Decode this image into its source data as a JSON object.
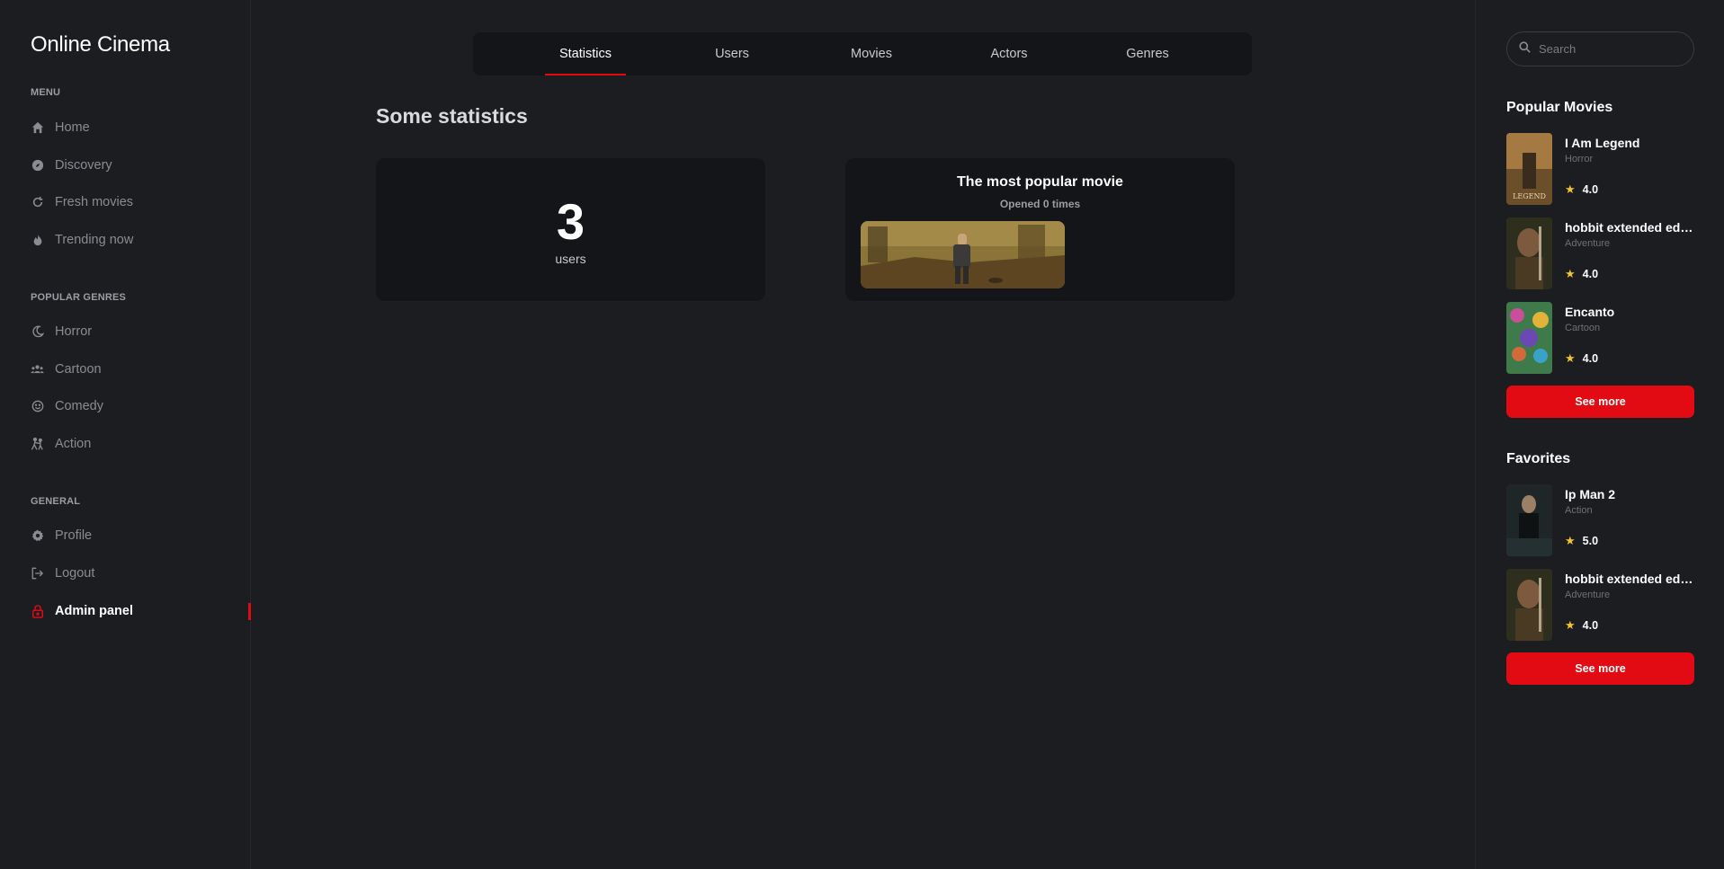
{
  "app": {
    "title": "Online Cinema"
  },
  "sidebar": {
    "menu_heading": "Menu",
    "menu": [
      {
        "label": "Home",
        "icon": "home-icon"
      },
      {
        "label": "Discovery",
        "icon": "compass-icon"
      },
      {
        "label": "Fresh movies",
        "icon": "refresh-icon"
      },
      {
        "label": "Trending now",
        "icon": "fire-icon"
      }
    ],
    "genres_heading": "Popular genres",
    "genres": [
      {
        "label": "Horror",
        "icon": "moon-icon"
      },
      {
        "label": "Cartoon",
        "icon": "users-icon"
      },
      {
        "label": "Comedy",
        "icon": "smile-icon"
      },
      {
        "label": "Action",
        "icon": "fighting-icon"
      }
    ],
    "general_heading": "General",
    "general": [
      {
        "label": "Profile",
        "icon": "gear-icon"
      },
      {
        "label": "Logout",
        "icon": "logout-icon"
      },
      {
        "label": "Admin panel",
        "icon": "lock-icon",
        "active": true
      }
    ]
  },
  "tabs": [
    {
      "label": "Statistics",
      "active": true
    },
    {
      "label": "Users"
    },
    {
      "label": "Movies"
    },
    {
      "label": "Actors"
    },
    {
      "label": "Genres"
    }
  ],
  "main": {
    "title": "Some statistics",
    "users_card": {
      "count": "3",
      "label": "users"
    },
    "popular_card": {
      "title": "The most popular movie",
      "subtitle": "Opened 0 times"
    }
  },
  "rightbar": {
    "search": {
      "placeholder": "Search",
      "value": ""
    },
    "popular_heading": "Popular Movies",
    "popular_movies": [
      {
        "title": "I Am Legend",
        "genre": "Horror",
        "rating": "4.0"
      },
      {
        "title": "hobbit extended edition",
        "genre": "Adventure",
        "rating": "4.0"
      },
      {
        "title": "Encanto",
        "genre": "Cartoon",
        "rating": "4.0"
      }
    ],
    "popular_see_more": "See more",
    "favorites_heading": "Favorites",
    "favorites": [
      {
        "title": "Ip Man 2",
        "genre": "Action",
        "rating": "5.0"
      },
      {
        "title": "hobbit extended edition",
        "genre": "Adventure",
        "rating": "4.0"
      }
    ],
    "favorites_see_more": "See more"
  },
  "colors": {
    "accent": "#e30b13",
    "background": "#1c1d21",
    "card": "#141518",
    "star": "#f4c430"
  }
}
